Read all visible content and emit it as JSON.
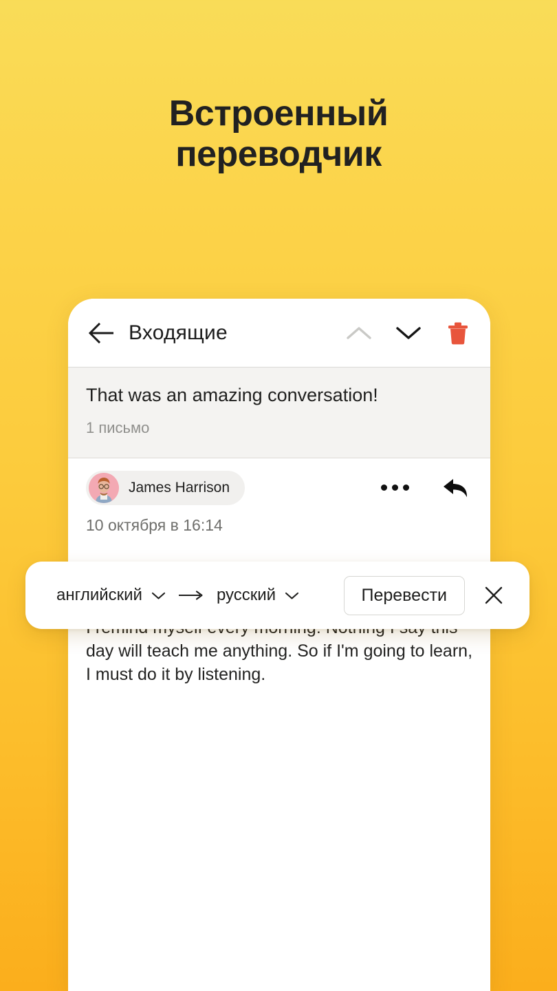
{
  "headline": {
    "line1": "Встроенный",
    "line2": "переводчик"
  },
  "colors": {
    "bg_top": "#F9DC58",
    "bg_bottom": "#FBAE1C",
    "trash": "#E8553C",
    "chevron_disabled": "#c9c9c6",
    "subject_bg": "#f4f3f1",
    "avatar_bg": "#f3a9b3"
  },
  "phone": {
    "appbar": {
      "back_icon": "arrow-left-icon",
      "title": "Входящие",
      "prev_icon": "chevron-up-icon",
      "next_icon": "chevron-down-icon",
      "delete_icon": "trash-icon"
    },
    "subject": {
      "title": "That was an amazing conversation!",
      "count": "1 письмо"
    },
    "message": {
      "sender_name": "James Harrison",
      "avatar_icon": "user-avatar",
      "more_icon": "ellipsis-icon",
      "reply_icon": "reply-arrow-icon",
      "date": "10 октября в 16:14",
      "body": "I remind myself every morning: Nothing I say this day will teach me anything. So if I'm going to learn, I must do it by listening."
    }
  },
  "translate_bar": {
    "source_lang": "английский",
    "source_chevron": "chevron-down-icon",
    "direction_icon": "arrow-right-icon",
    "target_lang": "русский",
    "target_chevron": "chevron-down-icon",
    "translate_label": "Перевести",
    "close_icon": "close-icon"
  }
}
